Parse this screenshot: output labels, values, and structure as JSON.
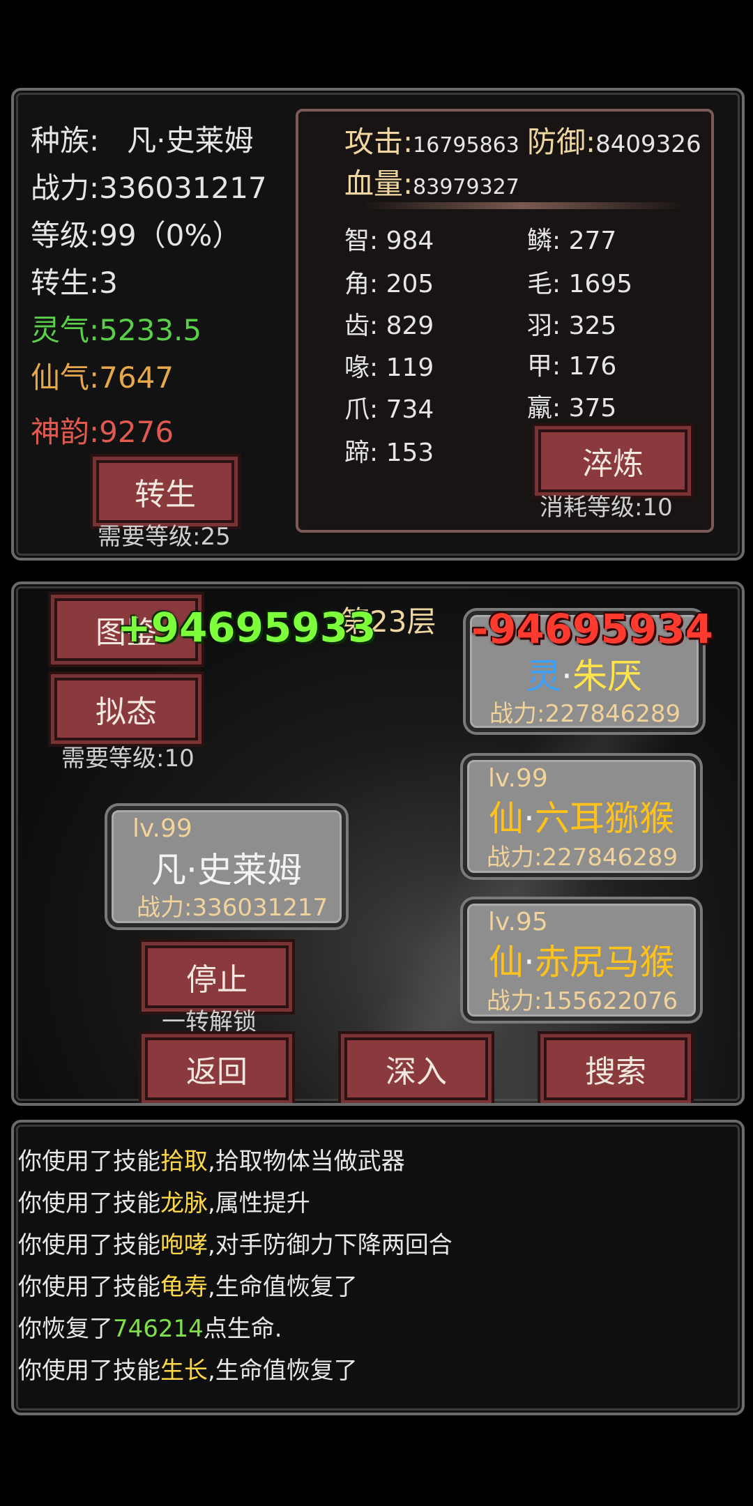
{
  "player": {
    "race_label": "种族:",
    "race_value": "凡·史莱姆",
    "power": "战力:336031217",
    "level": "等级:99（0%）",
    "rebirth": "转生:3",
    "lingqi": "灵气:5233.5",
    "xianqi": "仙气:7647",
    "shenyun": "神韵:9276",
    "rebirth_button": "转生",
    "rebirth_req": "需要等级:25"
  },
  "attributes": {
    "attack_label": "攻击:",
    "attack_value": "16795863",
    "defense_label": "防御:",
    "defense_value": "8409326",
    "hp_label": "血量:",
    "hp_value": "83979327",
    "left": [
      {
        "label": "智:",
        "value": "984"
      },
      {
        "label": "角:",
        "value": "205"
      },
      {
        "label": "齿:",
        "value": "829"
      },
      {
        "label": "喙:",
        "value": "119"
      },
      {
        "label": "爪:",
        "value": "734"
      },
      {
        "label": "蹄:",
        "value": "153"
      }
    ],
    "right": [
      {
        "label": "鳞:",
        "value": "277"
      },
      {
        "label": "毛:",
        "value": "1695"
      },
      {
        "label": "羽:",
        "value": "325"
      },
      {
        "label": "甲:",
        "value": "176"
      },
      {
        "label": "羸:",
        "value": "375"
      }
    ],
    "refine_button": "淬炼",
    "refine_cost": "消耗等级:10"
  },
  "battle": {
    "floor": "第23层",
    "atlas_button": "图鉴",
    "mimic_button": "拟态",
    "mimic_req": "需要等级:10",
    "damage_green": "+94695933",
    "damage_red": "-94695934",
    "player_card": {
      "lv": "lv.99",
      "name": "凡·史莱姆",
      "power": "战力:336031217"
    },
    "enemies": [
      {
        "lv": "",
        "prefix": "灵",
        "dot": "·",
        "name": "朱厌",
        "power": "战力:227846289",
        "prefix_color": "#3aa0ff"
      },
      {
        "lv": "lv.99",
        "prefix": "仙",
        "dot": "·",
        "name": "六耳猕猴",
        "power": "战力:227846289",
        "prefix_color": "#ffc21a"
      },
      {
        "lv": "lv.95",
        "prefix": "仙",
        "dot": "·",
        "name": "赤尻马猴",
        "power": "战力:155622076",
        "prefix_color": "#ffc21a"
      }
    ],
    "stop_button": "停止",
    "stop_hint": "一转解锁",
    "back_button": "返回",
    "deeper_button": "深入",
    "search_button": "搜索"
  },
  "log": [
    {
      "pre": "你使用了技能",
      "hl": "拾取",
      "post": ",拾取物体当做武器",
      "hl_color": "yellow"
    },
    {
      "pre": "你使用了技能",
      "hl": "龙脉",
      "post": ",属性提升",
      "hl_color": "yellow"
    },
    {
      "pre": "你使用了技能",
      "hl": "咆哮",
      "post": ",对手防御力下降两回合",
      "hl_color": "yellow"
    },
    {
      "pre": "你使用了技能",
      "hl": "龟寿",
      "post": ",生命值恢复了",
      "hl_color": "yellow"
    },
    {
      "pre": "你恢复了",
      "hl": "746214",
      "post": "点生命.",
      "hl_color": "green"
    },
    {
      "pre": "你使用了技能",
      "hl": "生长",
      "post": ",生命值恢复了",
      "hl_color": "yellow"
    }
  ],
  "colors": {
    "button_red": "#8a3a3c",
    "lingqi_green": "#5ad04a",
    "xianqi_gold": "#e6a84a",
    "shenyun_red": "#e05a50"
  }
}
